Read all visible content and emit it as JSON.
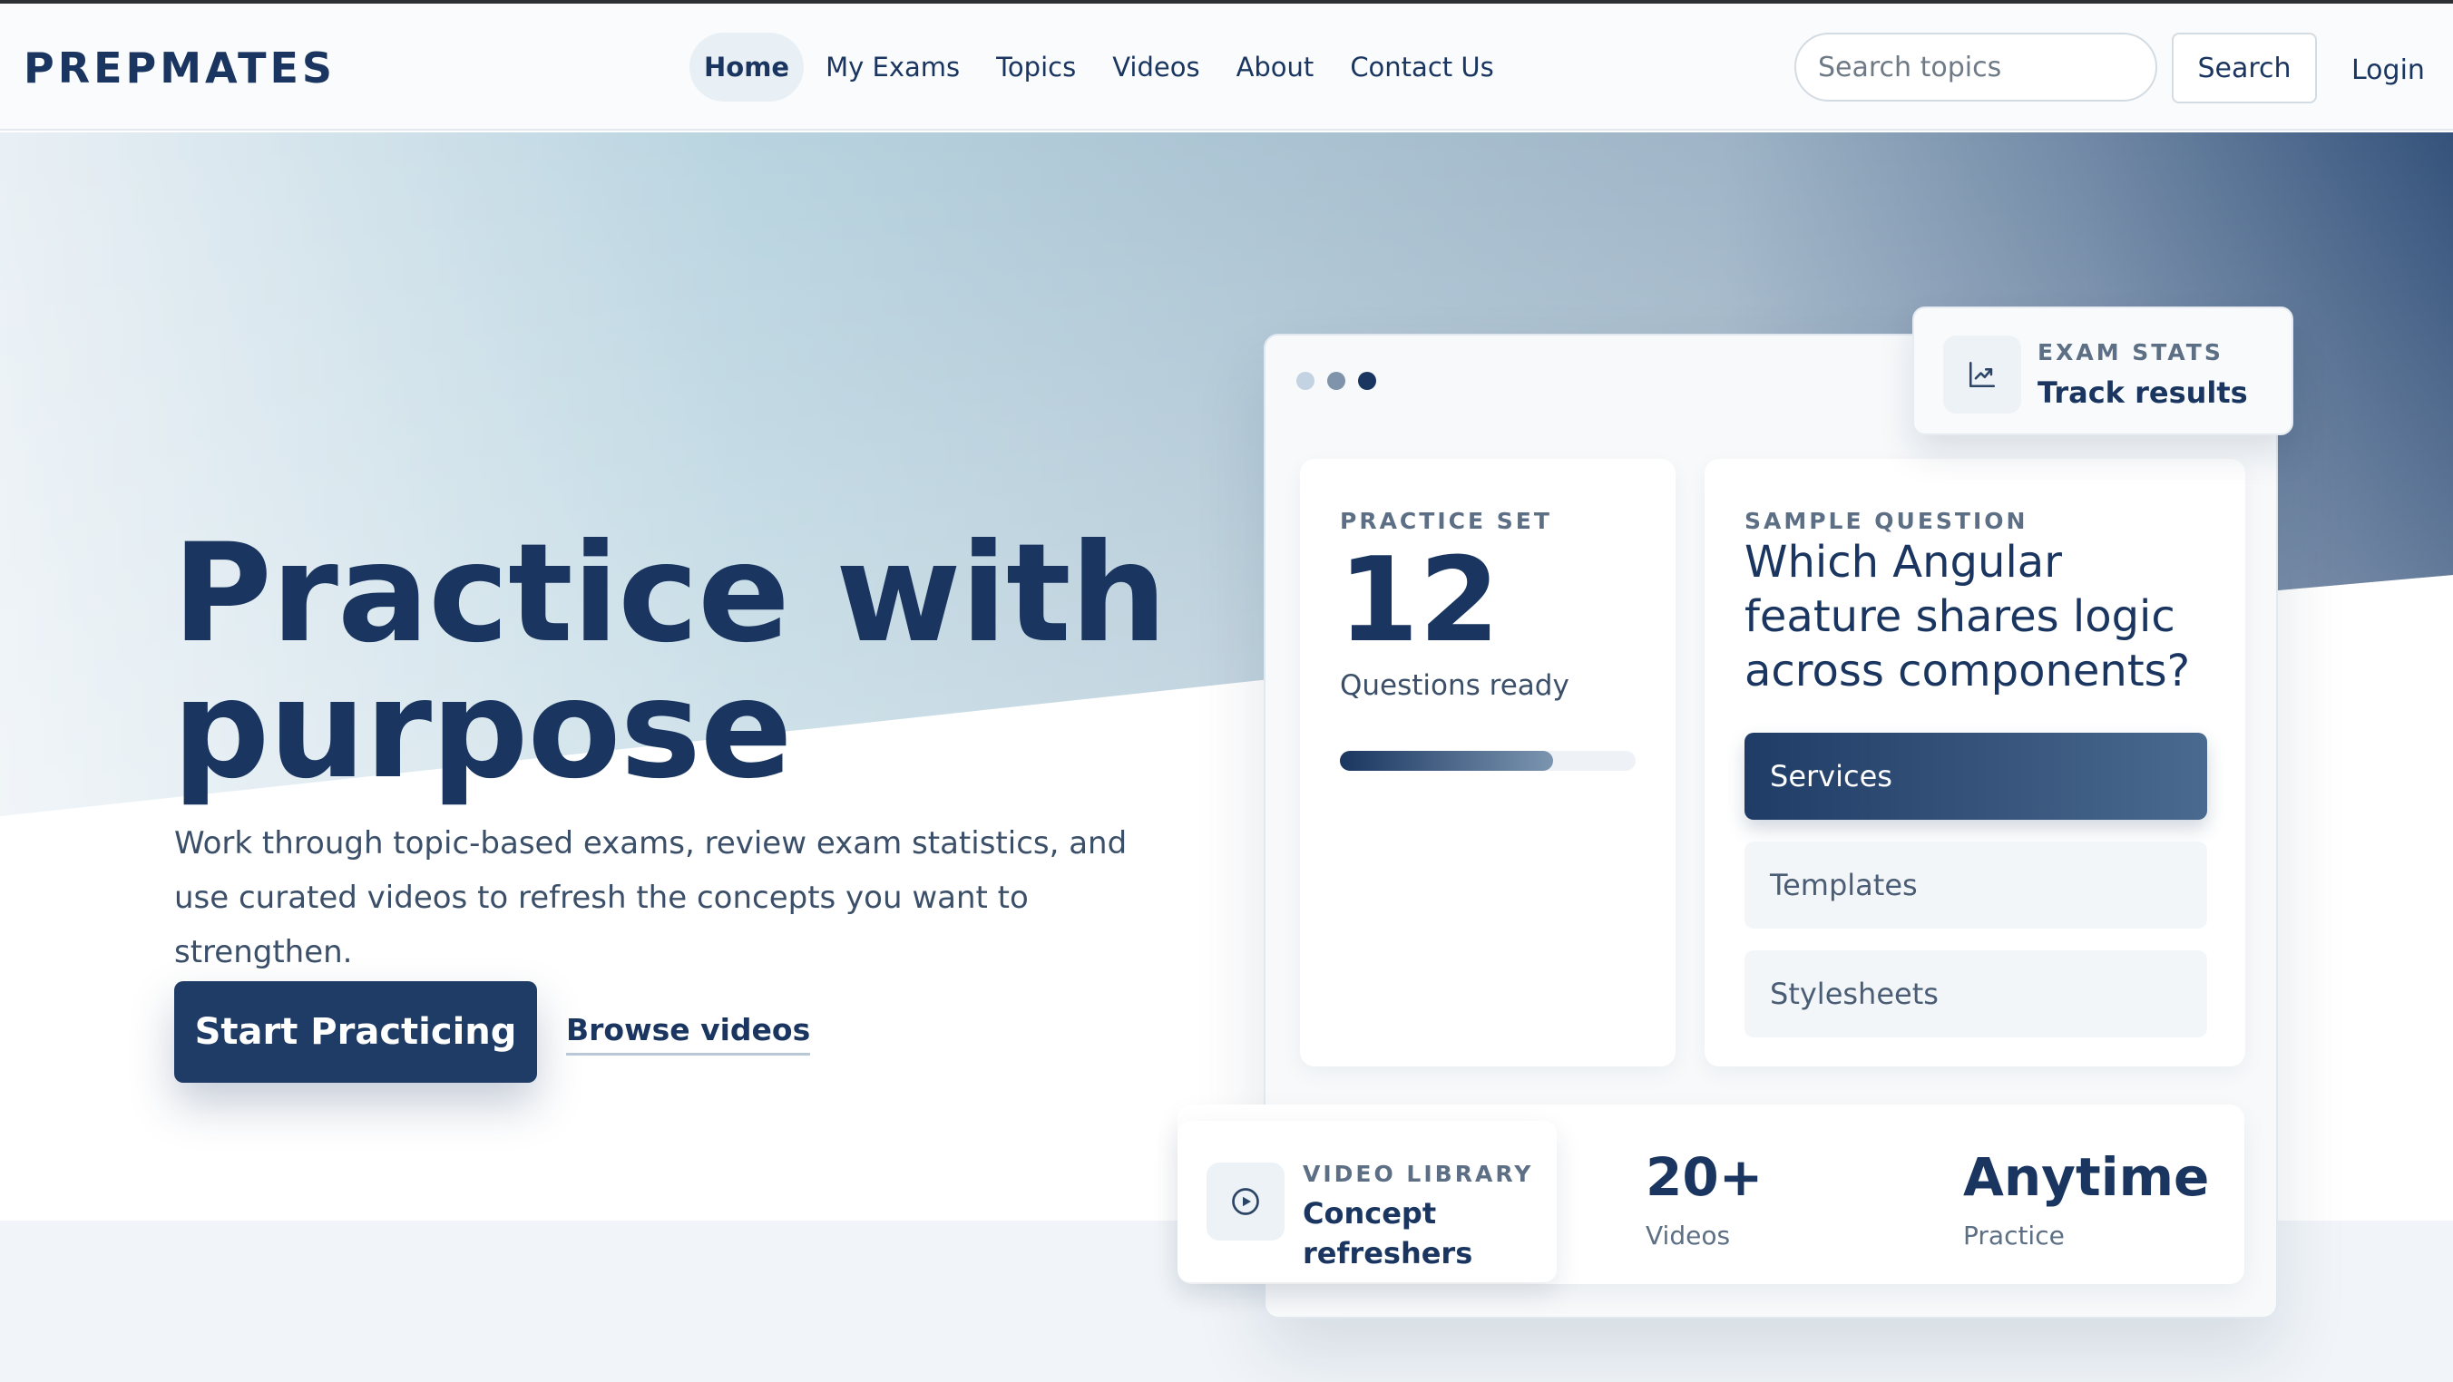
{
  "header": {
    "logo": "PREPMATES",
    "nav": [
      {
        "label": "Home",
        "active": true
      },
      {
        "label": "My Exams"
      },
      {
        "label": "Topics"
      },
      {
        "label": "Videos"
      },
      {
        "label": "About"
      },
      {
        "label": "Contact Us"
      }
    ],
    "search_placeholder": "Search topics",
    "search_button": "Search",
    "login": "Login"
  },
  "hero": {
    "headline_line1": "Practice with",
    "headline_line2": "purpose",
    "subtext": "Work through topic-based exams, review exam statistics, and use curated videos to refresh the concepts you want to strengthen.",
    "cta_primary": "Start Practicing",
    "cta_secondary": "Browse videos"
  },
  "card": {
    "window_dot_colors": [
      "#c3d3e2",
      "#7f94aa",
      "#1a3660"
    ],
    "practice": {
      "eyebrow": "PRACTICE SET",
      "count": "12",
      "label": "Questions ready",
      "progress_percent": 72
    },
    "question": {
      "eyebrow": "SAMPLE QUESTION",
      "text": "Which Angular feature shares logic across components?",
      "options": [
        {
          "label": "Services",
          "selected": true
        },
        {
          "label": "Templates"
        },
        {
          "label": "Stylesheets"
        }
      ]
    }
  },
  "stats_card": {
    "icon": "chart-line-icon",
    "eyebrow": "EXAM STATS",
    "title": "Track results"
  },
  "bottom": {
    "video_library": {
      "icon": "play-circle-icon",
      "eyebrow": "VIDEO LIBRARY",
      "title": "Concept refreshers"
    },
    "stats": [
      {
        "value": "20+",
        "label": "Videos"
      },
      {
        "value": "Anytime",
        "label": "Practice"
      }
    ]
  },
  "colors": {
    "brand_navy": "#1a3660",
    "accent_gradient_end": "#4b6a8f"
  }
}
